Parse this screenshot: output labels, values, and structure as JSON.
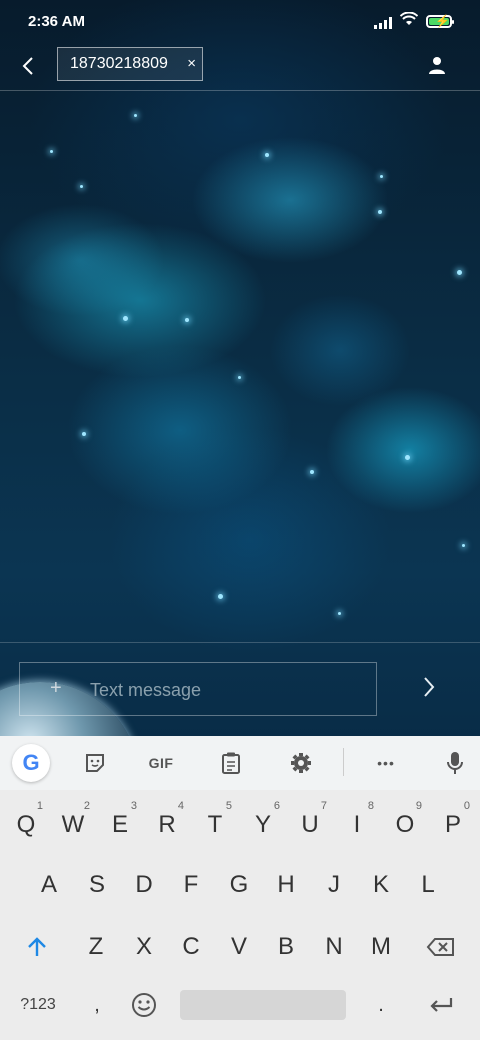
{
  "status": {
    "time": "2:36 AM"
  },
  "header": {
    "recipient": "18730218809",
    "chip_close": "×"
  },
  "compose": {
    "placeholder": "Text message",
    "plus": "+"
  },
  "keyboard": {
    "toolbar": {
      "google": "G",
      "gif": "GIF",
      "more": "•••"
    },
    "row1": [
      {
        "label": "Q",
        "hint": "1"
      },
      {
        "label": "W",
        "hint": "2"
      },
      {
        "label": "E",
        "hint": "3"
      },
      {
        "label": "R",
        "hint": "4"
      },
      {
        "label": "T",
        "hint": "5"
      },
      {
        "label": "Y",
        "hint": "6"
      },
      {
        "label": "U",
        "hint": "7"
      },
      {
        "label": "I",
        "hint": "8"
      },
      {
        "label": "O",
        "hint": "9"
      },
      {
        "label": "P",
        "hint": "0"
      }
    ],
    "row2": [
      "A",
      "S",
      "D",
      "F",
      "G",
      "H",
      "J",
      "K",
      "L"
    ],
    "row3": [
      "Z",
      "X",
      "C",
      "V",
      "B",
      "N",
      "M"
    ],
    "row4": {
      "symbols": "?123",
      "comma": ",",
      "period": "."
    }
  },
  "colors": {
    "accent": "#4285f4",
    "shift": "#1e88e5"
  }
}
